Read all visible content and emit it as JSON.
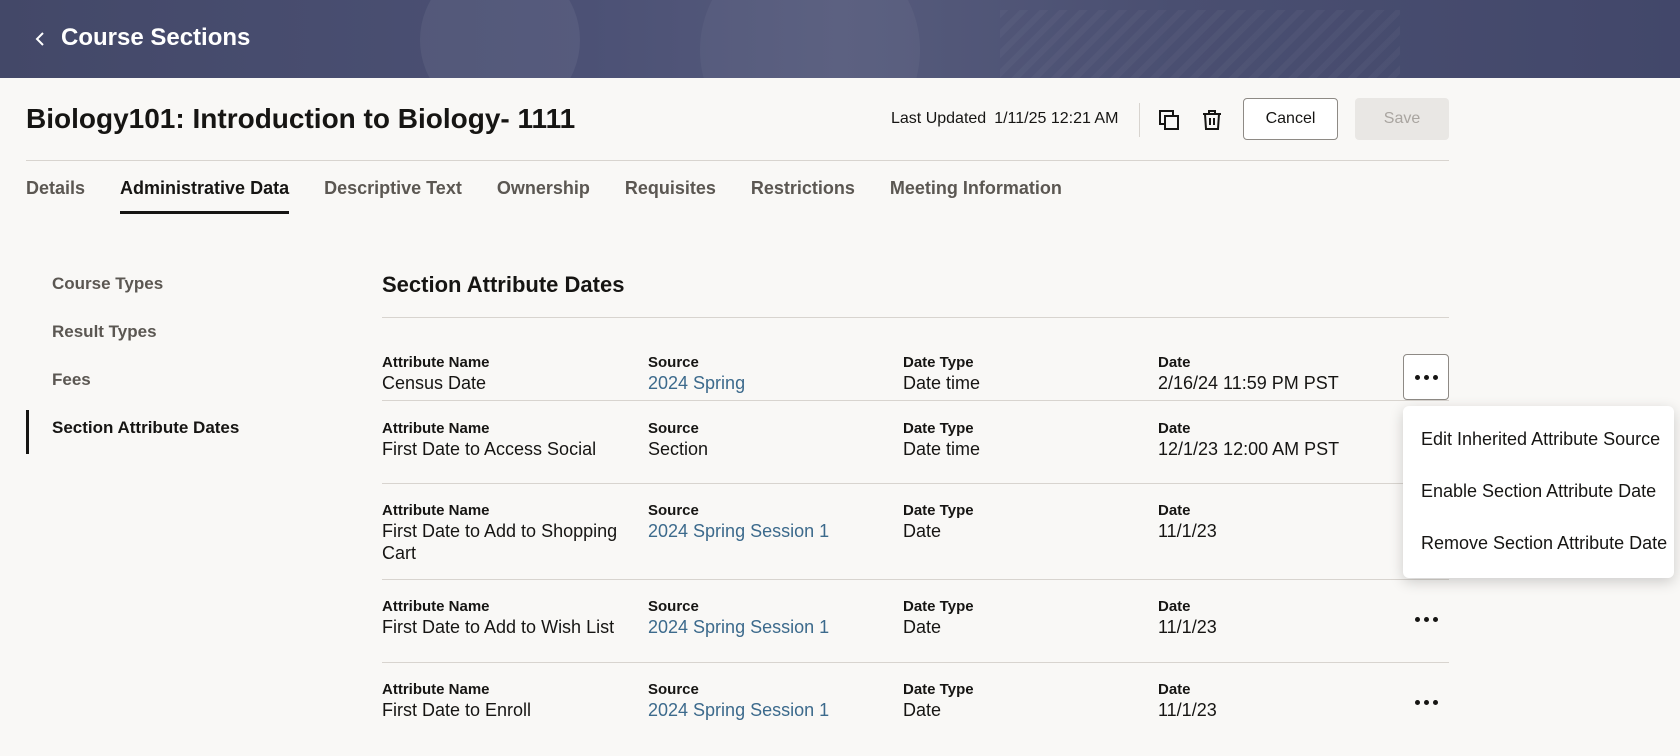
{
  "header": {
    "title": "Course Sections",
    "back_icon": "chevron-left-icon"
  },
  "page": {
    "title": "Biology101: Introduction to Biology- 1111",
    "last_updated_label": "Last Updated",
    "last_updated_value": "1/11/25 12:21 AM",
    "cancel_label": "Cancel",
    "save_label": "Save"
  },
  "tabs": [
    {
      "label": "Details"
    },
    {
      "label": "Administrative Data",
      "active": true
    },
    {
      "label": "Descriptive Text"
    },
    {
      "label": "Ownership"
    },
    {
      "label": "Requisites"
    },
    {
      "label": "Restrictions"
    },
    {
      "label": "Meeting Information"
    }
  ],
  "sidenav": [
    {
      "label": "Course Types"
    },
    {
      "label": "Result Types"
    },
    {
      "label": "Fees"
    },
    {
      "label": "Section Attribute Dates",
      "active": true
    }
  ],
  "section": {
    "title": "Section Attribute Dates",
    "columns": {
      "attribute_name": "Attribute Name",
      "source": "Source",
      "date_type": "Date Type",
      "date": "Date"
    },
    "rows": [
      {
        "attribute_name": "Census Date",
        "source": "2024 Spring",
        "source_link": true,
        "date_type": "Date time",
        "date": "2/16/24 11:59 PM PST",
        "has_menu": true,
        "menu_open": true
      },
      {
        "attribute_name": "First Date to Access Social",
        "source": "Section",
        "source_link": false,
        "date_type": "Date time",
        "date": "12/1/23 12:00 AM PST",
        "has_menu": false
      },
      {
        "attribute_name": "First Date to Add to Shopping Cart",
        "source": "2024 Spring Session 1",
        "source_link": true,
        "date_type": "Date",
        "date": "11/1/23",
        "has_menu": false
      },
      {
        "attribute_name": "First Date to Add to Wish List",
        "source": "2024 Spring Session 1",
        "source_link": true,
        "date_type": "Date",
        "date": "11/1/23",
        "has_menu": true
      },
      {
        "attribute_name": "First Date to Enroll",
        "source": "2024 Spring Session 1",
        "source_link": true,
        "date_type": "Date",
        "date": "11/1/23",
        "has_menu": true
      }
    ]
  },
  "menu": {
    "items": [
      {
        "label": "Edit Inherited Attribute Source"
      },
      {
        "label": "Enable Section Attribute Date"
      },
      {
        "label": "Remove Section Attribute Date"
      }
    ]
  },
  "colors": {
    "banner": "#4a4f71",
    "link": "#3c6a8c",
    "text": "#161513",
    "muted": "#5b5752"
  }
}
